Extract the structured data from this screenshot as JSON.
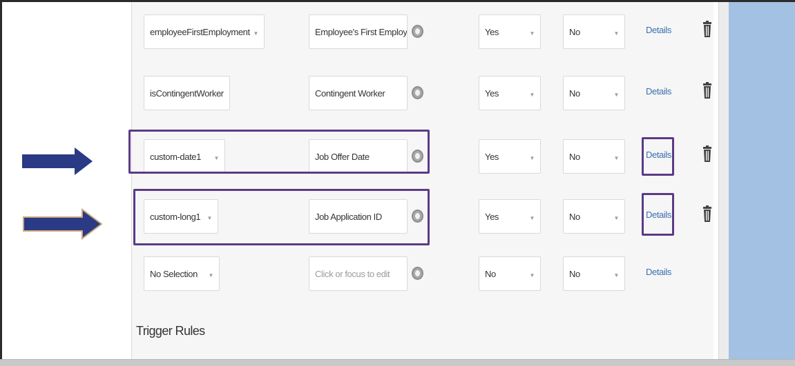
{
  "rows": [
    {
      "field": "employeeFirstEmployment",
      "label": "Employee's First Employm",
      "label_placeholder": false,
      "yes_value": "Yes",
      "no_value": "No",
      "details": "Details",
      "has_delete": true
    },
    {
      "field": "isContingentWorker",
      "label": "Contingent Worker",
      "label_placeholder": false,
      "yes_value": "Yes",
      "no_value": "No",
      "details": "Details",
      "has_delete": true
    },
    {
      "field": "custom-date1",
      "label": "Job Offer Date",
      "label_placeholder": false,
      "yes_value": "Yes",
      "no_value": "No",
      "details": "Details",
      "has_delete": true,
      "highlighted": true
    },
    {
      "field": "custom-long1",
      "label": "Job Application ID",
      "label_placeholder": false,
      "yes_value": "Yes",
      "no_value": "No",
      "details": "Details",
      "has_delete": true,
      "highlighted": true
    },
    {
      "field": "No Selection",
      "label": "Click or focus to edit",
      "label_placeholder": true,
      "yes_value": "No",
      "no_value": "No",
      "details": "Details",
      "has_delete": false
    }
  ],
  "trigger_rules_label": "Trigger Rules",
  "colors": {
    "highlight_border": "#5b3a86",
    "arrow_fill": "#2a3a84",
    "arrow_outline": "#c8a77b",
    "side_panel": "#a3c1e3",
    "link": "#3d6fb0"
  }
}
